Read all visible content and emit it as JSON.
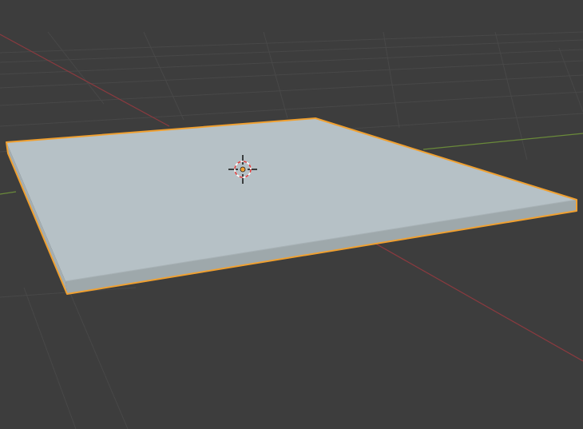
{
  "viewport": {
    "view": "perspective",
    "background_color": "#3d3d3d",
    "grid_color": "#484848",
    "x_axis_color": "#8b3a3f",
    "y_axis_color": "#6a8a3a"
  },
  "scene": {
    "object": {
      "type": "mesh-plane-slab",
      "selected": true,
      "top_face_color": "#b6c1c6",
      "side_face_color": "#9ea8ab",
      "outline_color": "#f0a030"
    },
    "cursor_3d": {
      "icon": "3d-cursor-icon",
      "ring_color_a": "#e04040",
      "ring_color_b": "#ffffff"
    },
    "origin_point": {
      "icon": "object-origin-icon",
      "color": "#f0a030"
    }
  }
}
